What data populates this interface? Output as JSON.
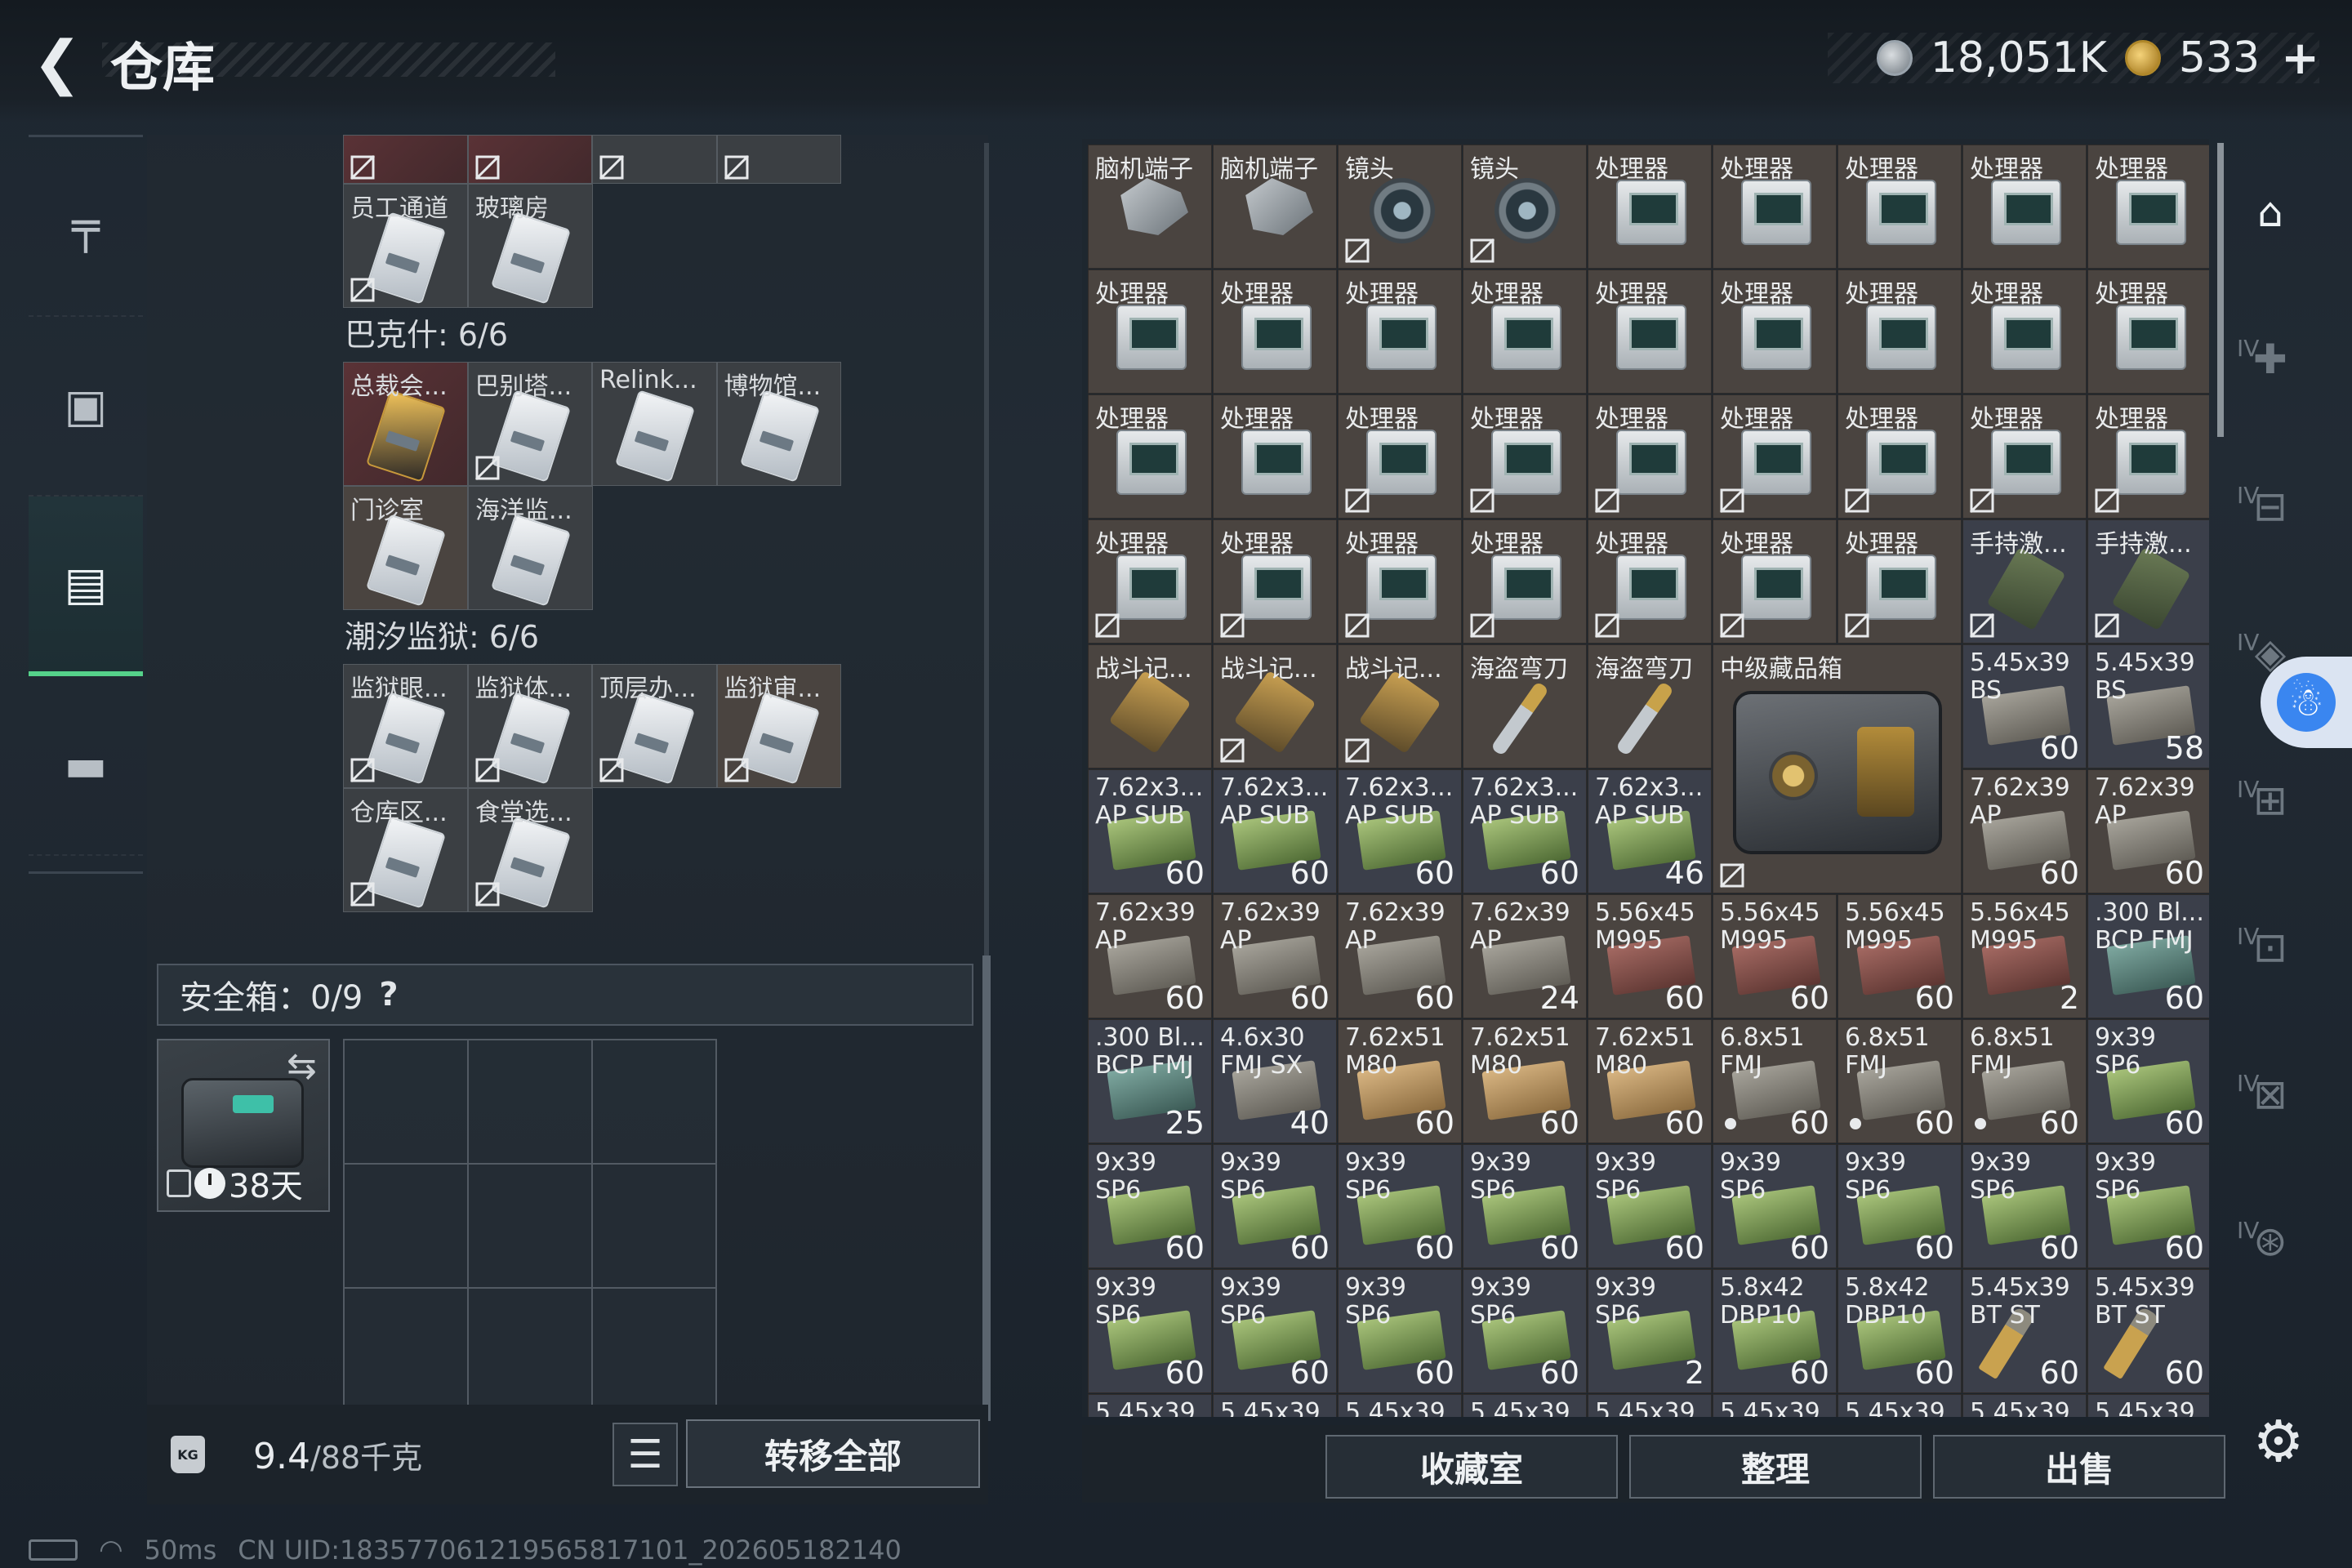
{
  "header": {
    "title": "仓库",
    "currency1": "18,051K",
    "currency2": "533",
    "plus": "+"
  },
  "sidebar": [
    {
      "name": "weapons",
      "icon": "gun-icon",
      "glyph": "╤"
    },
    {
      "name": "backpack",
      "icon": "backpack-icon",
      "glyph": "▣"
    },
    {
      "name": "storage",
      "icon": "locker-icon",
      "glyph": "▤"
    },
    {
      "name": "toolbox",
      "icon": "toolbox-icon",
      "glyph": "▬"
    }
  ],
  "keycards": {
    "top_partial": [
      "",
      "",
      "",
      ""
    ],
    "row_a": [
      "员工通道",
      "玻璃房"
    ],
    "group1_title": "巴克什: 6/6",
    "group1": [
      "总裁会...",
      "巴别塔...",
      "Relink...",
      "博物馆...",
      "门诊室",
      "海洋监..."
    ],
    "group2_title": "潮汐监狱: 6/6",
    "group2": [
      "监狱眼...",
      "监狱体...",
      "顶层办...",
      "监狱审...",
      "仓库区...",
      "食堂选..."
    ]
  },
  "safe": {
    "label": "安全箱：0/9",
    "help": "?",
    "days": "38天"
  },
  "bottom_left": {
    "weight": "9.4",
    "capacity": "/88千克",
    "list_glyph": "☰",
    "transfer": "转移全部"
  },
  "status": {
    "ping": "50ms",
    "uid": "CN UID:183577061219565817101_202605182140"
  },
  "inventory": [
    {
      "n": "脑机端子",
      "i": "chip"
    },
    {
      "n": "脑机端子",
      "i": "chip"
    },
    {
      "n": "镜头",
      "i": "lens",
      "x": true
    },
    {
      "n": "镜头",
      "i": "lens",
      "x": true
    },
    {
      "n": "处理器",
      "i": "proc"
    },
    {
      "n": "处理器",
      "i": "proc"
    },
    {
      "n": "处理器",
      "i": "proc"
    },
    {
      "n": "处理器",
      "i": "proc"
    },
    {
      "n": "处理器",
      "i": "proc"
    },
    {
      "n": "处理器",
      "i": "proc"
    },
    {
      "n": "处理器",
      "i": "proc"
    },
    {
      "n": "处理器",
      "i": "proc"
    },
    {
      "n": "处理器",
      "i": "proc"
    },
    {
      "n": "处理器",
      "i": "proc"
    },
    {
      "n": "处理器",
      "i": "proc"
    },
    {
      "n": "处理器",
      "i": "proc"
    },
    {
      "n": "处理器",
      "i": "proc"
    },
    {
      "n": "处理器",
      "i": "proc"
    },
    {
      "n": "处理器",
      "i": "proc"
    },
    {
      "n": "处理器",
      "i": "proc"
    },
    {
      "n": "处理器",
      "i": "proc",
      "x": true
    },
    {
      "n": "处理器",
      "i": "proc",
      "x": true
    },
    {
      "n": "处理器",
      "i": "proc",
      "x": true
    },
    {
      "n": "处理器",
      "i": "proc",
      "x": true
    },
    {
      "n": "处理器",
      "i": "proc",
      "x": true
    },
    {
      "n": "处理器",
      "i": "proc",
      "x": true
    },
    {
      "n": "处理器",
      "i": "proc",
      "x": true
    },
    {
      "n": "处理器",
      "i": "proc",
      "x": true
    },
    {
      "n": "处理器",
      "i": "proc",
      "x": true
    },
    {
      "n": "处理器",
      "i": "proc",
      "x": true
    },
    {
      "n": "处理器",
      "i": "proc",
      "x": true
    },
    {
      "n": "处理器",
      "i": "proc",
      "x": true
    },
    {
      "n": "处理器",
      "i": "proc",
      "x": true
    },
    {
      "n": "处理器",
      "i": "proc",
      "x": true
    },
    {
      "n": "手持激...",
      "i": "device",
      "x": true,
      "b": true
    },
    {
      "n": "手持激...",
      "i": "device",
      "x": true,
      "b": true
    },
    {
      "n": "战斗记...",
      "i": "badge"
    },
    {
      "n": "战斗记...",
      "i": "badge",
      "x": true
    },
    {
      "n": "战斗记...",
      "i": "badge",
      "x": true
    },
    {
      "n": "海盗弯刀",
      "i": "knife"
    },
    {
      "n": "海盗弯刀",
      "i": "knife"
    },
    {
      "n": "中级藏品箱",
      "i": "crate",
      "tall": true,
      "x": true
    },
    {
      "n": "5.45x39",
      "s": "BS",
      "i": "ammo",
      "c": "60",
      "b": true
    },
    {
      "n": "5.45x39",
      "s": "BS",
      "i": "ammo",
      "c": "58",
      "b": true
    },
    {
      "n": "7.62x3...",
      "s": "AP SUB",
      "i": "ammo green",
      "c": "60",
      "b": true
    },
    {
      "n": "7.62x3...",
      "s": "AP SUB",
      "i": "ammo green",
      "c": "60",
      "b": true
    },
    {
      "n": "7.62x3...",
      "s": "AP SUB",
      "i": "ammo green",
      "c": "60",
      "b": true
    },
    {
      "n": "7.62x3...",
      "s": "AP SUB",
      "i": "ammo green",
      "c": "60",
      "b": true
    },
    {
      "n": "7.62x3...",
      "s": "AP SUB",
      "i": "ammo green",
      "c": "46",
      "b": true
    },
    {
      "n": "7.62x39",
      "s": "AP",
      "i": "ammo",
      "c": "60"
    },
    {
      "n": "7.62x39",
      "s": "AP",
      "i": "ammo",
      "c": "60"
    },
    {
      "n": "7.62x39",
      "s": "AP",
      "i": "ammo",
      "c": "60"
    },
    {
      "n": "7.62x39",
      "s": "AP",
      "i": "ammo",
      "c": "60"
    },
    {
      "n": "7.62x39",
      "s": "AP",
      "i": "ammo",
      "c": "60"
    },
    {
      "n": "7.62x39",
      "s": "AP",
      "i": "ammo",
      "c": "24"
    },
    {
      "n": "5.56x45",
      "s": "M995",
      "i": "ammo red",
      "c": "60"
    },
    {
      "n": "5.56x45",
      "s": "M995",
      "i": "ammo red",
      "c": "60"
    },
    {
      "n": "5.56x45",
      "s": "M995",
      "i": "ammo red",
      "c": "60"
    },
    {
      "n": "5.56x45",
      "s": "M995",
      "i": "ammo red",
      "c": "2"
    },
    {
      "n": ".300 Bl...",
      "s": "BCP FMJ",
      "i": "ammo teal",
      "c": "60",
      "b": true
    },
    {
      "n": ".300 Bl...",
      "s": "BCP FMJ",
      "i": "ammo teal",
      "c": "25",
      "b": true
    },
    {
      "n": "4.6x30",
      "s": "FMJ SX",
      "i": "ammo",
      "c": "40",
      "b": true
    },
    {
      "n": "7.62x51",
      "s": "M80",
      "i": "ammo tan",
      "c": "60"
    },
    {
      "n": "7.62x51",
      "s": "M80",
      "i": "ammo tan",
      "c": "60"
    },
    {
      "n": "7.62x51",
      "s": "M80",
      "i": "ammo tan",
      "c": "60"
    },
    {
      "n": "6.8x51",
      "s": "FMJ",
      "i": "ammo",
      "c": "60",
      "d": true
    },
    {
      "n": "6.8x51",
      "s": "FMJ",
      "i": "ammo",
      "c": "60",
      "d": true
    },
    {
      "n": "6.8x51",
      "s": "FMJ",
      "i": "ammo",
      "c": "60",
      "d": true
    },
    {
      "n": "9x39",
      "s": "SP6",
      "i": "ammo green",
      "c": "60",
      "b": true
    },
    {
      "n": "9x39",
      "s": "SP6",
      "i": "ammo green",
      "c": "60",
      "b": true
    },
    {
      "n": "9x39",
      "s": "SP6",
      "i": "ammo green",
      "c": "60",
      "b": true
    },
    {
      "n": "9x39",
      "s": "SP6",
      "i": "ammo green",
      "c": "60",
      "b": true
    },
    {
      "n": "9x39",
      "s": "SP6",
      "i": "ammo green",
      "c": "60",
      "b": true
    },
    {
      "n": "9x39",
      "s": "SP6",
      "i": "ammo green",
      "c": "60",
      "b": true
    },
    {
      "n": "9x39",
      "s": "SP6",
      "i": "ammo green",
      "c": "60",
      "b": true
    },
    {
      "n": "9x39",
      "s": "SP6",
      "i": "ammo green",
      "c": "60",
      "b": true
    },
    {
      "n": "9x39",
      "s": "SP6",
      "i": "ammo green",
      "c": "60",
      "b": true
    },
    {
      "n": "9x39",
      "s": "SP6",
      "i": "ammo green",
      "c": "60",
      "b": true
    },
    {
      "n": "9x39",
      "s": "SP6",
      "i": "ammo green",
      "c": "60",
      "b": true
    },
    {
      "n": "9x39",
      "s": "SP6",
      "i": "ammo green",
      "c": "60",
      "b": true
    },
    {
      "n": "9x39",
      "s": "SP6",
      "i": "ammo green",
      "c": "60",
      "b": true
    },
    {
      "n": "9x39",
      "s": "SP6",
      "i": "ammo green",
      "c": "60",
      "b": true
    },
    {
      "n": "9x39",
      "s": "SP6",
      "i": "ammo green",
      "c": "2",
      "b": true
    },
    {
      "n": "5.8x42",
      "s": "DBP10",
      "i": "ammo green",
      "c": "60",
      "b": true
    },
    {
      "n": "5.8x42",
      "s": "DBP10",
      "i": "ammo green",
      "c": "60",
      "b": true
    },
    {
      "n": "5.45x39",
      "s": "BT ST",
      "i": "round",
      "c": "60",
      "b": true
    },
    {
      "n": "5.45x39",
      "s": "BT ST",
      "i": "round",
      "c": "60",
      "b": true
    },
    {
      "n": "5.45x39",
      "i": "ammo",
      "b": true
    },
    {
      "n": "5.45x39",
      "i": "ammo",
      "b": true
    },
    {
      "n": "5.45x39",
      "i": "ammo",
      "b": true
    },
    {
      "n": "5.45x39",
      "i": "ammo",
      "b": true
    },
    {
      "n": "5.45x39",
      "i": "ammo",
      "b": true
    },
    {
      "n": "5.45x39",
      "i": "ammo",
      "b": true
    },
    {
      "n": "5.45x39",
      "i": "ammo",
      "b": true
    },
    {
      "n": "5.45x39",
      "i": "ammo",
      "b": true
    },
    {
      "n": "5.45x39",
      "i": "ammo",
      "b": true
    }
  ],
  "bottom_right": {
    "collection": "收藏室",
    "organize": "整理",
    "sell": "出售"
  },
  "right_rail": [
    {
      "name": "home",
      "icon": "base-icon",
      "glyph": "⌂",
      "lvl": ""
    },
    {
      "name": "medical",
      "icon": "medical-station-icon",
      "glyph": "✚",
      "lvl": "IV"
    },
    {
      "name": "workbench",
      "icon": "workbench-icon",
      "glyph": "⊟",
      "lvl": "IV"
    },
    {
      "name": "tech",
      "icon": "tech-station-icon",
      "glyph": "◈",
      "lvl": "IV"
    },
    {
      "name": "armory",
      "icon": "armory-icon",
      "glyph": "⊞",
      "lvl": "IV"
    },
    {
      "name": "gear-station",
      "icon": "gear-station-icon",
      "glyph": "⊡",
      "lvl": "IV"
    },
    {
      "name": "vehicle",
      "icon": "vehicle-icon",
      "glyph": "⊠",
      "lvl": "IV"
    },
    {
      "name": "extra",
      "icon": "upgrade-icon",
      "glyph": "⊛",
      "lvl": "IV"
    }
  ],
  "colors": {
    "accent": "#55d28a",
    "slot_brown": "#4a4440",
    "slot_blue": "#3b3f4a"
  }
}
